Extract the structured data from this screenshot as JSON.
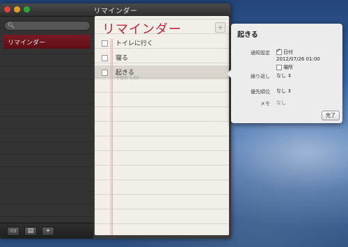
{
  "window": {
    "title": "リマインダー"
  },
  "sidebar": {
    "search_placeholder": "",
    "lists": [
      {
        "label": "リマインダー",
        "selected": true
      }
    ],
    "bottom_buttons": [
      "show-calendar",
      "show-list",
      "+"
    ]
  },
  "main": {
    "title": "リマインダー",
    "add_label": "+",
    "items": [
      {
        "text": "トイレに行く",
        "sub": ""
      },
      {
        "text": "寝る",
        "sub": ""
      },
      {
        "text": "起きる",
        "sub": "今日の 1:00"
      }
    ]
  },
  "popover": {
    "title": "起きる",
    "alarm_label": "通知設定",
    "date_option": "日付",
    "date_value": "2012/07/26  01:00",
    "location_option": "場所",
    "repeat_label": "繰り返し",
    "repeat_value": "なし",
    "priority_label": "優先順位",
    "priority_value": "なし",
    "memo_label": "メモ",
    "memo_value": "なし",
    "done_label": "完了"
  },
  "colors": {
    "accent": "#c2243a",
    "selected_list": "#7a1a24"
  }
}
